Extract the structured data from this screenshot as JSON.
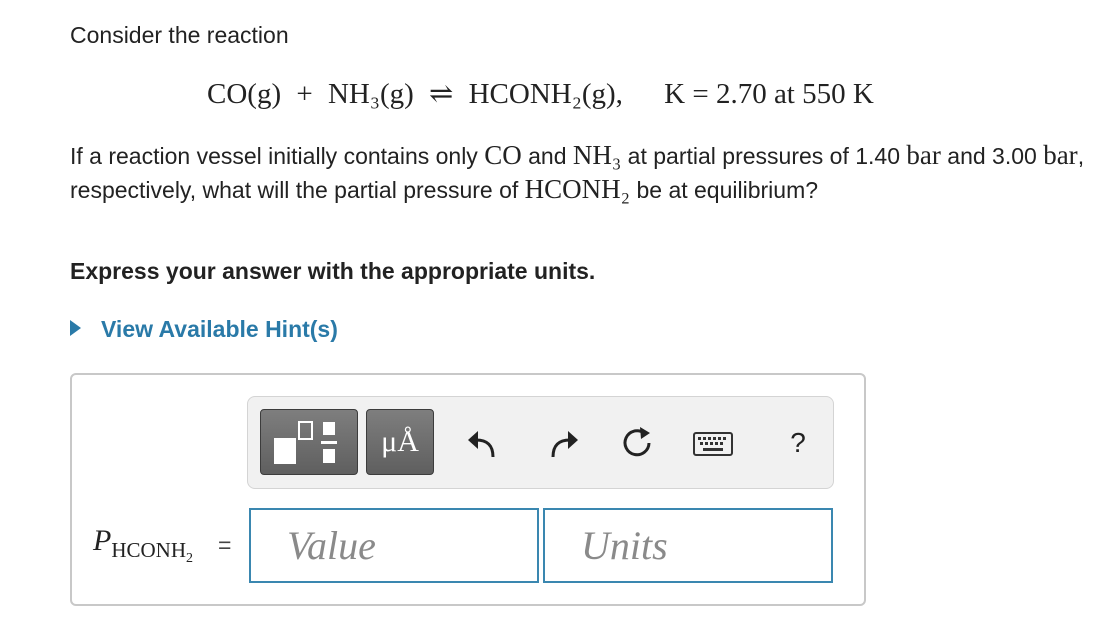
{
  "problem": {
    "intro": "Consider the reaction",
    "equation": {
      "reactant1": "CO(g)",
      "plus": "+",
      "reactant2": "NH₃(g)",
      "arrow": "⇌",
      "product": "HCONH₂(g),",
      "k_expr": "K = 2.70 at 550 K"
    },
    "question": {
      "part1": "If a reaction vessel initially contains only ",
      "co": "CO",
      "part2": " and ",
      "nh3": "NH₃",
      "part3": " at partial pressures of 1.40 ",
      "bar1": "bar",
      "part4": " and 3.00 ",
      "bar2": "bar",
      "part5": ", respectively, what will the partial pressure of ",
      "hconh2": "HCONH₂",
      "part6": " be at equilibrium?"
    },
    "instruction": "Express your answer with the appropriate units.",
    "hint_label": "View Available Hint(s)"
  },
  "toolbar": {
    "unit_button_label": "μÅ",
    "help_label": "?",
    "icons": [
      "templates-icon",
      "units-icon",
      "undo-icon",
      "redo-icon",
      "reset-icon",
      "keyboard-icon",
      "help-icon"
    ]
  },
  "answer": {
    "label_main": "P",
    "label_sub": "HCONH",
    "label_subsub": "2",
    "equals": "=",
    "value_placeholder": "Value",
    "units_placeholder": "Units"
  },
  "colors": {
    "link": "#2a7aa8",
    "field_border": "#3a87b0",
    "button_dark": "#6b6b6b"
  }
}
